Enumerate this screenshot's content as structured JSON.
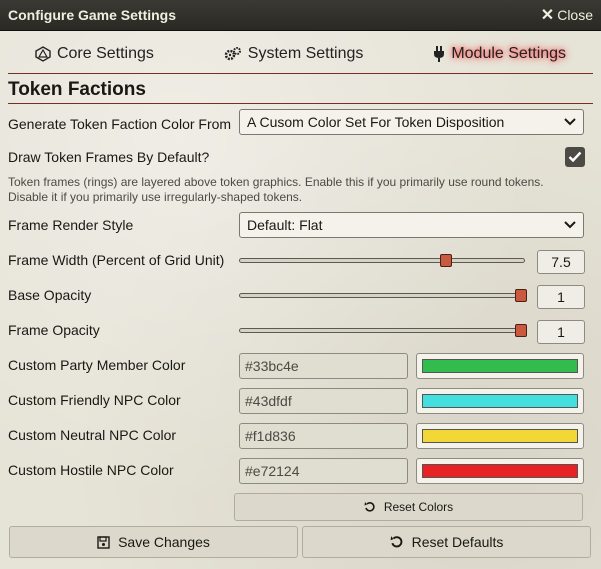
{
  "window": {
    "title": "Configure Game Settings",
    "close_label": "Close"
  },
  "tabs": [
    {
      "label": "Core Settings",
      "icon": "d20-icon",
      "active": false
    },
    {
      "label": "System Settings",
      "icon": "gears-icon",
      "active": false
    },
    {
      "label": "Module Settings",
      "icon": "plug-icon",
      "active": true
    }
  ],
  "section": {
    "title": "Token Factions"
  },
  "settings": {
    "faction_color_source": {
      "label": "Generate Token Faction Color From",
      "value": "A Cusom Color Set For Token Disposition"
    },
    "draw_frames": {
      "label": "Draw Token Frames By Default?",
      "checked": true,
      "hint_line1": "Token frames (rings) are layered above token graphics. Enable this if you primarily use round tokens.",
      "hint_line2": "Disable it if you primarily use irregularly-shaped tokens."
    },
    "frame_render_style": {
      "label": "Frame Render Style",
      "value": "Default: Flat"
    },
    "frame_width": {
      "label": "Frame Width (Percent of Grid Unit)",
      "value": "7.5",
      "fraction": 0.73
    },
    "base_opacity": {
      "label": "Base Opacity",
      "value": "1",
      "fraction": 1.0
    },
    "frame_opacity": {
      "label": "Frame Opacity",
      "value": "1",
      "fraction": 1.0
    },
    "colors": [
      {
        "label": "Custom Party Member Color",
        "hex": "#33bc4e"
      },
      {
        "label": "Custom Friendly NPC Color",
        "hex": "#43dfdf"
      },
      {
        "label": "Custom Neutral NPC Color",
        "hex": "#f1d836"
      },
      {
        "label": "Custom Hostile NPC Color",
        "hex": "#e72124"
      }
    ]
  },
  "buttons": {
    "reset_colors": "Reset Colors",
    "save_changes": "Save Changes",
    "reset_defaults": "Reset Defaults"
  },
  "theme": {
    "accent": "#782e22",
    "titlebar": "#2f2e29",
    "thumb": "#c9593f"
  }
}
